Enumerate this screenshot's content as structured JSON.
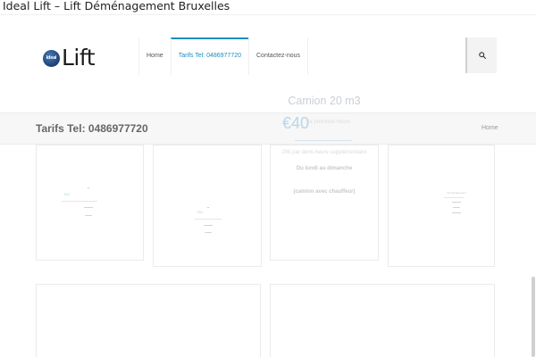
{
  "browser": {
    "tab_title": "Ideal Lift – Lift Déménagement Bruxelles"
  },
  "header": {
    "logo": {
      "badge_text": "Ideal",
      "word": "Lift"
    },
    "nav": [
      {
        "label": "Home",
        "active": false
      },
      {
        "label": "Tarifs Tel: 0486977720",
        "active": true
      },
      {
        "label": "Contactez-nous",
        "active": false
      }
    ],
    "search_icon": "search-icon"
  },
  "title_bar": {
    "title": "Tarifs Tel: 0486977720",
    "breadcrumb": "Home"
  },
  "faded_overlay": {
    "title": "Camion 20 m3",
    "price": "€40",
    "price_note": "la première heure",
    "extra": "20€ par demi-heure supplémentaire",
    "days": "Du lundi au dimanche",
    "driver": "(camion avec chauffeur)"
  },
  "cards": {
    "card1": {
      "price": "€50"
    },
    "card2": {
      "price": "€60"
    },
    "card4": {
      "title": "Déménagement"
    }
  },
  "colors": {
    "accent": "#1e8cbe",
    "title_bar_bg": "#f7f7f7",
    "logo_badge": "#1d3f73"
  }
}
